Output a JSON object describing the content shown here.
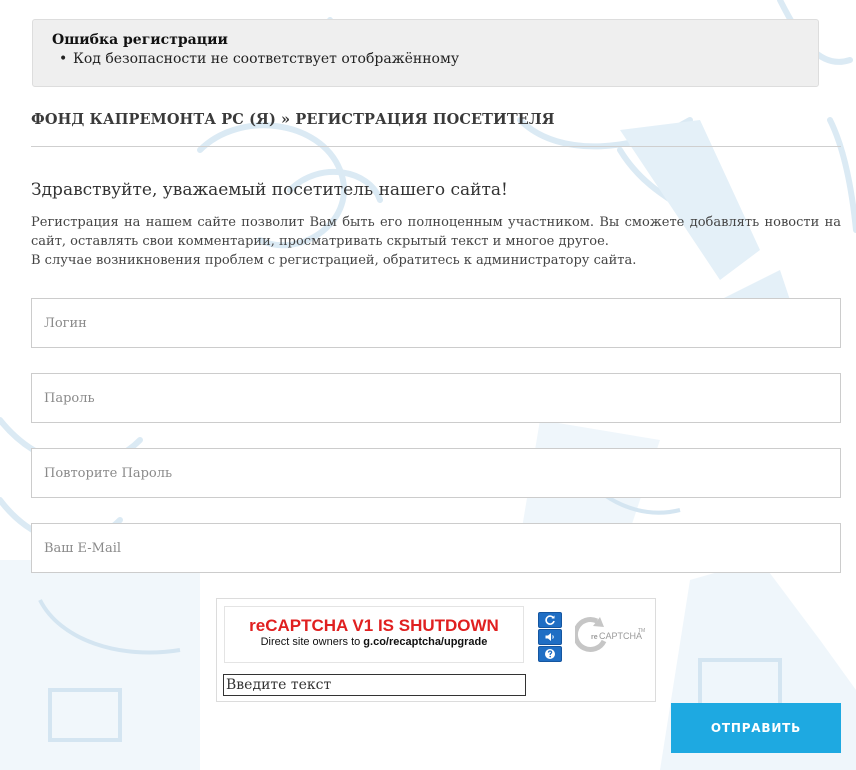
{
  "error": {
    "title": "Ошибка регистрации",
    "items": [
      "Код безопасности не соответствует отображённому"
    ]
  },
  "breadcrumb": "ФОНД КАПРЕМОНТА РС (Я) » РЕГИСТРАЦИЯ ПОСЕТИТЕЛЯ",
  "greeting": "Здравствуйте, уважаемый посетитель нашего сайта!",
  "intro": {
    "paragraph1": "Регистрация на нашем сайте позволит Вам быть его полноценным участником. Вы сможете добавлять новости на сайт, оставлять свои комментарии, просматривать скрытый текст и многое другое.",
    "paragraph2": "В случае возникновения проблем с регистрацией, обратитесь к администратору сайта."
  },
  "form": {
    "login_placeholder": "Логин",
    "password_placeholder": "Пароль",
    "password_repeat_placeholder": "Повторите Пароль",
    "email_placeholder": "Ваш E-Mail"
  },
  "captcha": {
    "headline": "reCAPTCHA V1 IS SHUTDOWN",
    "sub_prefix": "Direct site owners to ",
    "sub_link": "g.co/recaptcha/upgrade",
    "input_placeholder": "Введите текст",
    "logo_text": "reCAPTCHA",
    "logo_prefix": "re",
    "tm": "TM"
  },
  "submit_label": "ОТПРАВИТЬ",
  "colors": {
    "accent": "#1ea9e1",
    "captcha_red": "#e02020",
    "captcha_button": "#1f6ec4",
    "decor": "#dbeaf4"
  }
}
